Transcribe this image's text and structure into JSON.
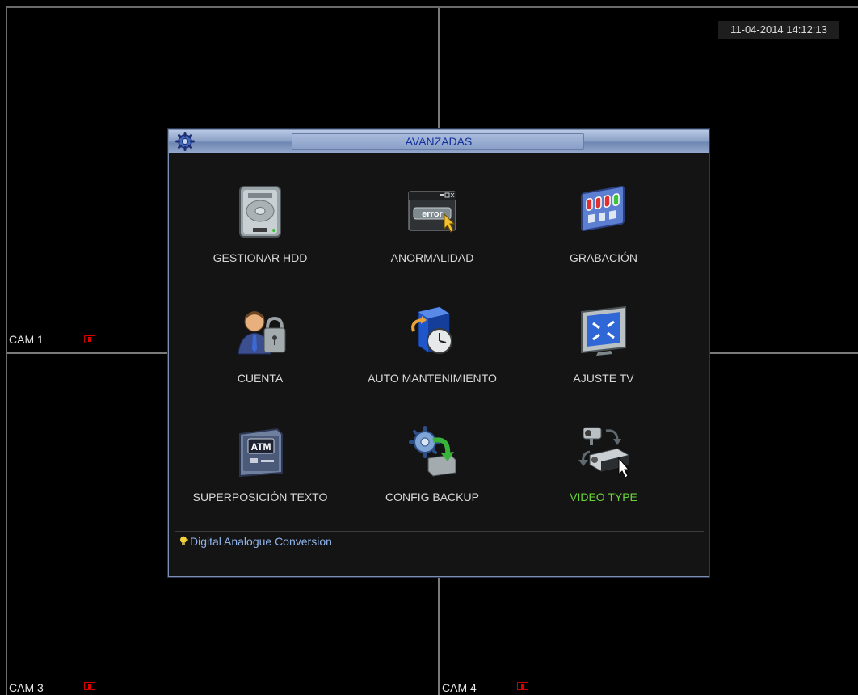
{
  "datetime": "11-04-2014 14:12:13",
  "cameras": [
    "CAM 1",
    "CAM 3",
    "CAM 4"
  ],
  "dialog": {
    "title": "AVANZADAS",
    "hint": "Digital Analogue Conversion",
    "items": [
      {
        "label": "GESTIONAR HDD",
        "icon": "hdd-icon"
      },
      {
        "label": "ANORMALIDAD",
        "icon": "error-window-icon"
      },
      {
        "label": "GRABACIÓN",
        "icon": "record-panel-icon"
      },
      {
        "label": "CUENTA",
        "icon": "user-lock-icon"
      },
      {
        "label": "AUTO MANTENIMIENTO",
        "icon": "server-clock-icon"
      },
      {
        "label": "AJUSTE TV",
        "icon": "tv-adjust-icon"
      },
      {
        "label": "SUPERPOSICIÓN TEXTO",
        "icon": "atm-text-icon"
      },
      {
        "label": "CONFIG BACKUP",
        "icon": "backup-gear-icon"
      },
      {
        "label": "VIDEO TYPE",
        "icon": "video-type-icon",
        "selected": true
      }
    ]
  },
  "colors": {
    "selected_label": "#6cd23a",
    "title_text": "#1230a0",
    "hint_text": "#8fb4ec"
  }
}
